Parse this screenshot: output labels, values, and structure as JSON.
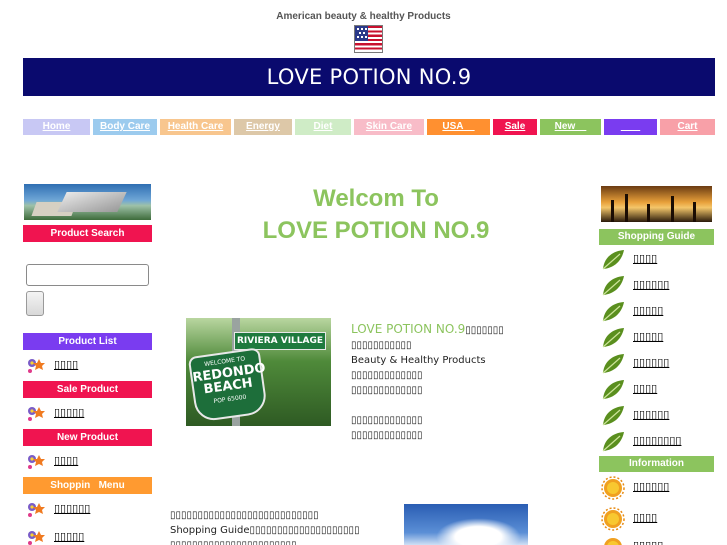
{
  "header": {
    "caption": "American beauty & healthy Products",
    "banner_title": "LOVE POTION NO.9"
  },
  "nav": [
    {
      "label": "Home",
      "color": "#c8c8f4"
    },
    {
      "label": "Body Care",
      "color": "#9ccbee"
    },
    {
      "label": "Health Care",
      "color": "#f8c68e"
    },
    {
      "label": "Energy",
      "color": "#ddc8a8"
    },
    {
      "label": "Diet",
      "color": "#cfecc6"
    },
    {
      "label": "Skin Care",
      "color": "#f8bcc8"
    },
    {
      "label": "USA    ",
      "color": "#ff9030"
    },
    {
      "label": "Sale",
      "color": "#f01450"
    },
    {
      "label": "New    ",
      "color": "#8cc45e"
    },
    {
      "label": "       ",
      "color": "#7a3cf0"
    },
    {
      "label": "Cart",
      "color": "#f8a0a8"
    }
  ],
  "left": {
    "product_search": "Product Search",
    "product_list": "Product List",
    "product_list_items": [
      "▯▯▯▯"
    ],
    "sale_product": "Sale Product",
    "sale_items": [
      "▯▯▯▯▯"
    ],
    "new_product": "New Product",
    "new_items": [
      "▯▯▯▯"
    ],
    "shopping_menu": "Shoppin   Menu",
    "shopping_items": [
      "▯▯▯▯▯▯",
      "▯▯▯▯▯"
    ]
  },
  "main": {
    "welcome_line1": "Welcom To",
    "welcome_line2": "LOVE POTION NO.9",
    "intro_brand": "LOVE POTION NO.9",
    "intro_after_brand": "▯▯▯▯▯▯▯",
    "intro_line2": "▯▯▯▯▯▯▯▯▯▯▯",
    "intro_line3": "Beauty & Healthy Products",
    "intro_line4": "▯▯▯▯▯▯▯▯▯▯▯▯▯",
    "intro_line5": "▯▯▯▯▯▯▯▯▯▯▯▯▯",
    "intro_line6": "▯▯▯▯▯▯▯▯▯▯▯▯▯",
    "intro_line7": "▯▯▯▯▯▯▯▯▯▯▯▯▯",
    "bottom_line1": "▯▯▯▯▯▯▯▯▯▯▯▯▯▯▯▯▯▯▯▯▯▯▯▯▯▯▯",
    "bottom_line2": "Shopping Guide▯▯▯▯▯▯▯▯▯▯▯▯▯▯▯▯▯▯▯▯",
    "bottom_line3": "▯▯▯▯▯▯▯▯▯▯▯▯▯▯▯▯▯▯▯▯▯▯▯"
  },
  "right": {
    "shopping_guide": "Shopping Guide",
    "guide_items": [
      "▯▯▯▯",
      "▯▯▯▯▯▯",
      "▯▯▯▯▯",
      "▯▯▯▯▯",
      "▯▯▯▯▯▯",
      "▯▯▯▯",
      "▯▯▯▯▯▯",
      "▯▯▯▯▯▯▯▯"
    ],
    "information": "Information",
    "info_items": [
      "▯▯▯▯▯▯",
      "▯▯▯▯",
      "▯▯▯▯▯"
    ]
  },
  "colors": {
    "banner_bg": "#0a0a6e",
    "welcome_green": "#8cc45e",
    "product_search_hdr": "#f01450",
    "product_list_hdr": "#7a3cf0",
    "sale_product_hdr": "#f01450",
    "new_product_hdr": "#f01450",
    "shopping_menu_hdr": "#ff9a30",
    "right_hdr": "#8cc45e"
  },
  "icons": {
    "left_item_icon": "flower-sparkle-icon",
    "guide_item_icon": "leaf-icon",
    "info_item_icon": "sun-icon"
  }
}
